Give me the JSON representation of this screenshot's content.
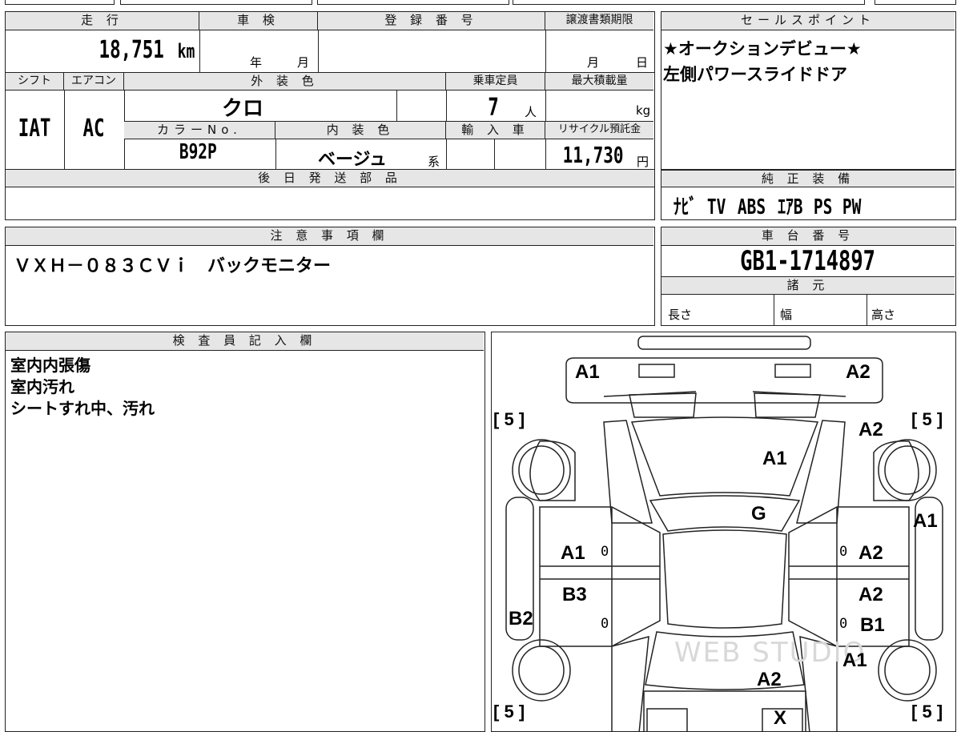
{
  "top_strip": [
    "",
    "",
    "",
    "",
    ""
  ],
  "headers": {
    "mileage": "走 行",
    "inspection": "車 検",
    "registration": "登 録 番 号",
    "transfer_deadline": "譲渡書類期限",
    "sales_point": "セールスポイント",
    "shift": "シフト",
    "aircon": "エアコン",
    "exterior_color": "外 装 色",
    "capacity": "乗車定員",
    "max_load": "最大積載量",
    "color_no": "カラーNo.",
    "interior_color": "内 装 色",
    "import": "輸 入 車",
    "recycle": "リサイクル預託金",
    "later_parts": "後 日 発 送 部 品",
    "genuine_equipment": "純 正 装 備",
    "notes": "注 意 事 項 欄",
    "chassis_number": "車 台 番 号",
    "specs": "諸 元",
    "inspector": "検 査 員 記 入 欄"
  },
  "vehicle": {
    "mileage": "18,751",
    "mileage_unit": "km",
    "inspection_year_unit": "年",
    "inspection_month_unit": "月",
    "transfer_month_unit": "月",
    "transfer_day_unit": "日",
    "shift": "IAT",
    "aircon": "AC",
    "exterior_color": "クロ",
    "capacity": "7",
    "capacity_unit": "人",
    "max_load_unit": "kg",
    "color_no": "B92P",
    "interior_color": "ベージュ",
    "interior_suffix": "系",
    "recycle_fee": "11,730",
    "recycle_unit": "円",
    "chassis_number": "GB1-1714897"
  },
  "sales_points": [
    "★オークションデビュー★",
    "左側パワースライドドア"
  ],
  "genuine_equipment": [
    "ﾅﾋﾞ",
    "TV",
    "ABS",
    "ｴｱB",
    "PS",
    "PW"
  ],
  "notes_text": "ＶＸＨ－０８３ＣＶｉ　バックモニター",
  "specs": {
    "length": "長さ",
    "width": "幅",
    "height": "高さ"
  },
  "inspector_notes": [
    "室内内張傷",
    "室内汚れ",
    "シートすれ中、汚れ"
  ],
  "diagram": {
    "labels": [
      {
        "id": "front-left-corner",
        "text": "A1"
      },
      {
        "id": "front-right-corner",
        "text": "A2"
      },
      {
        "id": "right-front-fender",
        "text": "A2"
      },
      {
        "id": "hood",
        "text": "A1"
      },
      {
        "id": "windshield",
        "text": "G"
      },
      {
        "id": "right-rocker",
        "text": "A1"
      },
      {
        "id": "left-front-door",
        "text": "A1"
      },
      {
        "id": "right-front-door",
        "text": "A2"
      },
      {
        "id": "left-rear-door",
        "text": "B3"
      },
      {
        "id": "right-rear-door-a",
        "text": "A2"
      },
      {
        "id": "right-rear-door-b",
        "text": "B1"
      },
      {
        "id": "left-rocker",
        "text": "B2"
      },
      {
        "id": "right-rear-fender",
        "text": "A1"
      },
      {
        "id": "roof-rear",
        "text": "A2"
      },
      {
        "id": "rear-mark",
        "text": "X"
      }
    ],
    "tires": [
      "5",
      "5",
      "5",
      "5"
    ],
    "digits": [
      "0",
      "0",
      "0",
      "0"
    ],
    "watermark": "WEB STUDIO"
  }
}
